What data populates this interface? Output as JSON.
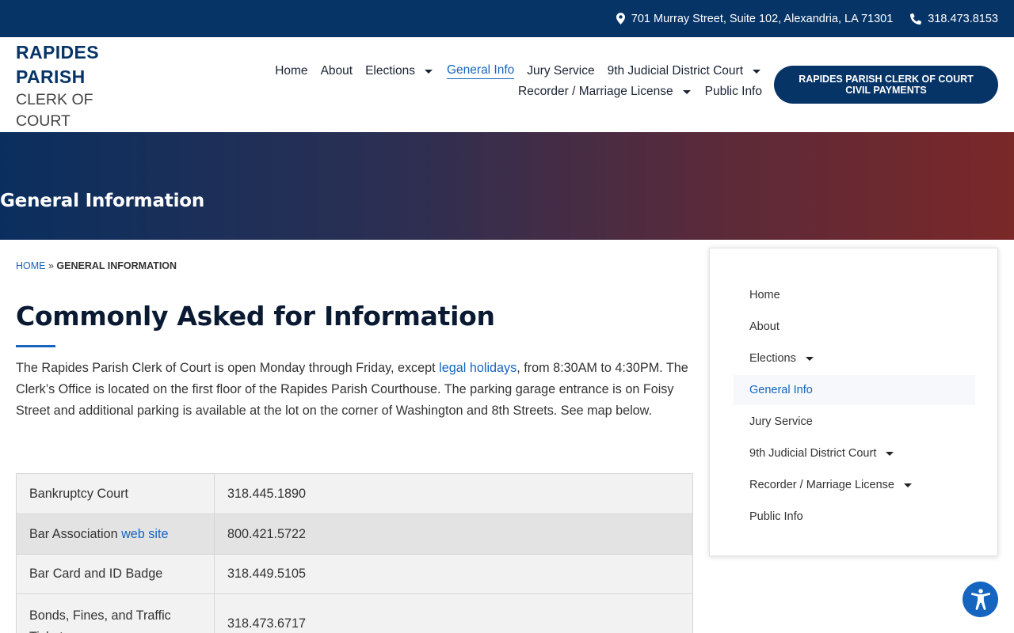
{
  "topbar": {
    "address": "701 Murray Street, Suite 102, Alexandria, LA 71301",
    "phone": "318.473.8153"
  },
  "logo": {
    "line1": "RAPIDES",
    "line2": "PARISH",
    "line3": "CLERK OF",
    "line4": "COURT"
  },
  "nav": {
    "row1": [
      {
        "label": "Home",
        "dropdown": false
      },
      {
        "label": "About",
        "dropdown": false
      },
      {
        "label": "Elections",
        "dropdown": true
      },
      {
        "label": "General Info",
        "dropdown": false,
        "active": true
      },
      {
        "label": "Jury Service",
        "dropdown": false
      },
      {
        "label": "9th Judicial District Court",
        "dropdown": true
      }
    ],
    "row2": [
      {
        "label": "Recorder / Marriage License",
        "dropdown": true
      },
      {
        "label": "Public Info",
        "dropdown": false
      }
    ]
  },
  "pay_button": "RAPIDES PARISH CLERK OF COURT CIVIL PAYMENTS",
  "hero": {
    "title": "General Information"
  },
  "breadcrumb": {
    "home": "HOME",
    "separator": "»",
    "current": "GENERAL INFORMATION"
  },
  "content": {
    "title": "Commonly Asked for Information",
    "intro_before": "The Rapides Parish Clerk of Court is open Monday through Friday, except ",
    "intro_link": "legal holidays",
    "intro_after": ", from 8:30AM to 4:30PM. The Clerk’s Office is located on the first floor of the Rapides Parish Courthouse. The parking garage entrance is on Foisy Street and additional parking is available at the lot on the corner of Washington and 8th Streets. See map below."
  },
  "table": {
    "rows": [
      {
        "name": "Bankruptcy Court",
        "phone": "318.445.1890"
      },
      {
        "name": "Bar Association ",
        "link": "web site",
        "phone": "800.421.5722"
      },
      {
        "name": "Bar Card and ID Badge",
        "phone": "318.449.5105"
      },
      {
        "name": "Bonds, Fines, and Traffic Tickets",
        "phone": "318.473.6717"
      }
    ]
  },
  "sidebar": {
    "items": [
      {
        "label": "Home",
        "dropdown": false
      },
      {
        "label": "About",
        "dropdown": false
      },
      {
        "label": "Elections",
        "dropdown": true
      },
      {
        "label": "General Info",
        "dropdown": false,
        "active": true
      },
      {
        "label": "Jury Service",
        "dropdown": false
      },
      {
        "label": "9th Judicial District Court",
        "dropdown": true
      },
      {
        "label": "Recorder / Marriage License",
        "dropdown": true
      },
      {
        "label": "Public Info",
        "dropdown": false
      }
    ]
  },
  "icons": {
    "address": "map-pin-icon",
    "phone": "phone-icon",
    "accessibility": "accessibility-icon"
  },
  "colors": {
    "brand_navy": "#073466",
    "link_blue": "#1565c0",
    "hero_gradient_end": "#7a2828"
  }
}
